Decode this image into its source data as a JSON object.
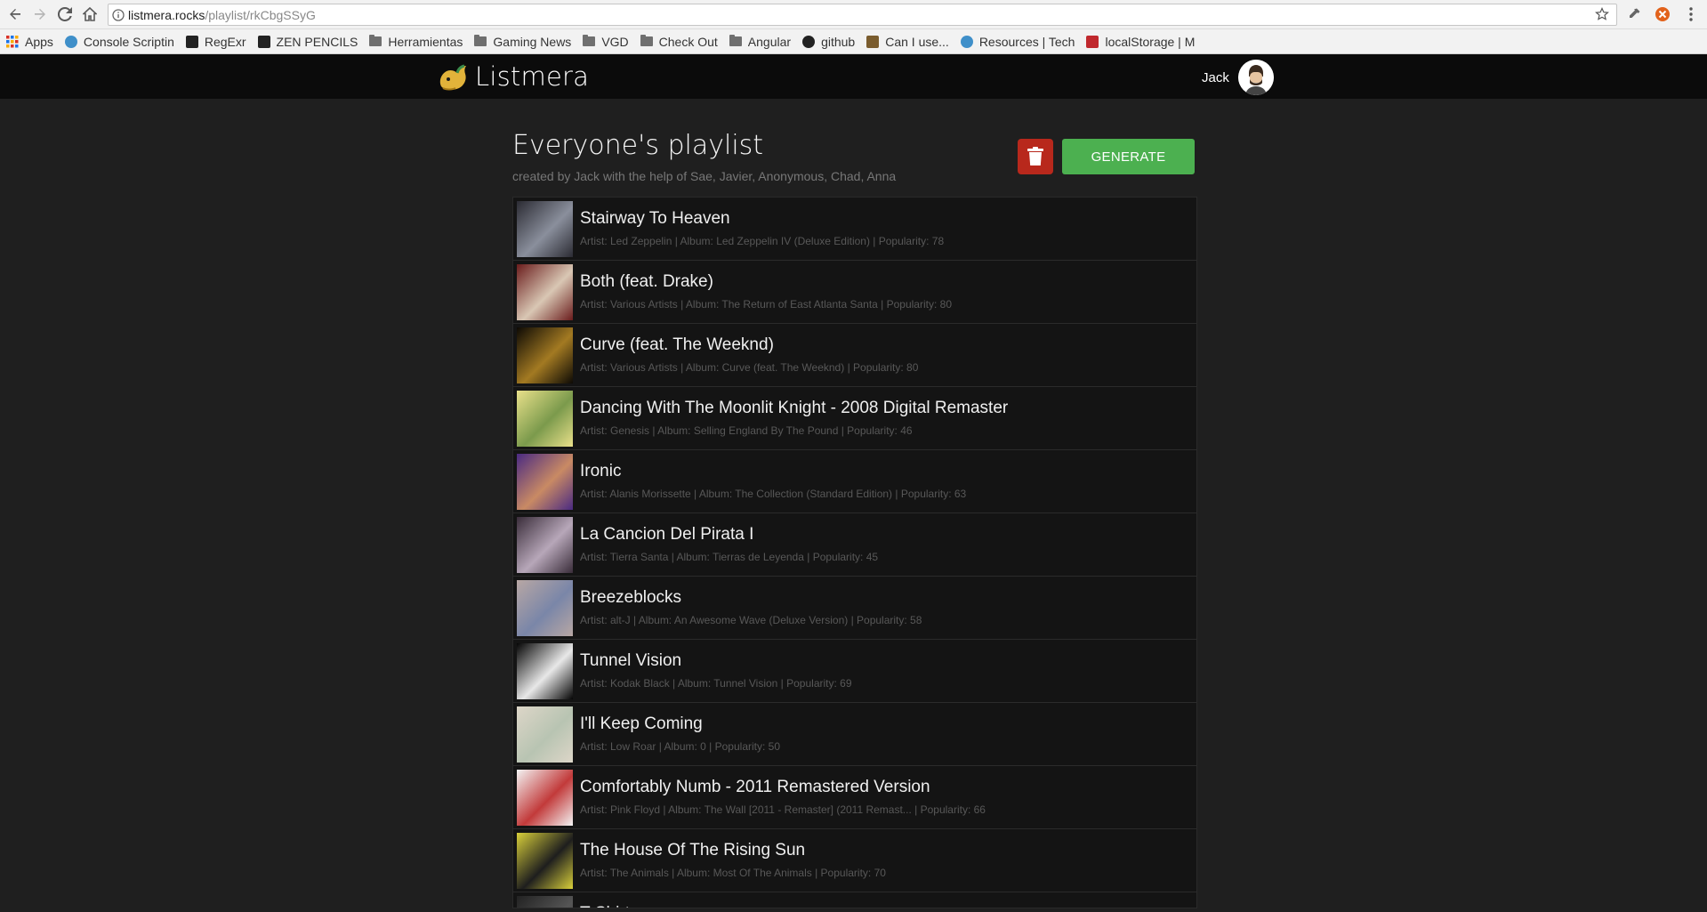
{
  "browser": {
    "url_host": "listmera.rocks",
    "url_path": "/playlist/rkCbgSSyG"
  },
  "bookmarks": [
    {
      "label": "Apps",
      "icon": "apps-grid-icon",
      "color": "#d93025"
    },
    {
      "label": "Console Scriptin",
      "icon": "globe-icon",
      "color": "#3f8fc9"
    },
    {
      "label": "RegExr",
      "icon": "regexr-icon",
      "color": "#222222"
    },
    {
      "label": "ZEN PENCILS",
      "icon": "zen-pencils-icon",
      "color": "#222222"
    },
    {
      "label": "Herramientas",
      "icon": "folder-icon",
      "color": "#6f6f6f"
    },
    {
      "label": "Gaming News",
      "icon": "folder-icon",
      "color": "#6f6f6f"
    },
    {
      "label": "VGD",
      "icon": "folder-icon",
      "color": "#6f6f6f"
    },
    {
      "label": "Check Out",
      "icon": "folder-icon",
      "color": "#6f6f6f"
    },
    {
      "label": "Angular",
      "icon": "folder-icon",
      "color": "#6f6f6f"
    },
    {
      "label": "github",
      "icon": "github-icon",
      "color": "#222222"
    },
    {
      "label": "Can I use...",
      "icon": "caniuse-icon",
      "color": "#7a5c2e"
    },
    {
      "label": "Resources | Tech",
      "icon": "resources-icon",
      "color": "#3f8fc9"
    },
    {
      "label": "localStorage | M",
      "icon": "mdn-icon",
      "color": "#c0282d"
    }
  ],
  "header": {
    "app_name": "Listmera",
    "user_name": "Jack"
  },
  "playlist": {
    "title": "Everyone's playlist",
    "subtitle": "created by Jack with the help of Sae, Javier, Anonymous, Chad, Anna",
    "generate_label": "GENERATE",
    "tracks": [
      {
        "title": "Stairway To Heaven",
        "meta": "Artist: Led Zeppelin | Album: Led Zeppelin IV (Deluxe Edition) | Popularity: 78",
        "cover_colors": [
          "#2b2b33",
          "#8a8f9c"
        ]
      },
      {
        "title": "Both (feat. Drake)",
        "meta": "Artist: Various Artists | Album: The Return of East Atlanta Santa | Popularity: 80",
        "cover_colors": [
          "#6a1c1c",
          "#d9c7b4"
        ]
      },
      {
        "title": "Curve (feat. The Weeknd)",
        "meta": "Artist: Various Artists | Album: Curve (feat. The Weeknd) | Popularity: 80",
        "cover_colors": [
          "#0d0a05",
          "#a37a22"
        ]
      },
      {
        "title": "Dancing With The Moonlit Knight - 2008 Digital Remaster",
        "meta": "Artist: Genesis | Album: Selling England By The Pound | Popularity: 46",
        "cover_colors": [
          "#e9e08a",
          "#7b9a4c"
        ]
      },
      {
        "title": "Ironic",
        "meta": "Artist: Alanis Morissette | Album: The Collection (Standard Edition) | Popularity: 63",
        "cover_colors": [
          "#4a2a82",
          "#c98a64"
        ]
      },
      {
        "title": "La Cancion Del Pirata I",
        "meta": "Artist: Tierra Santa | Album: Tierras de Leyenda | Popularity: 45",
        "cover_colors": [
          "#3a2d3a",
          "#b7a7b9"
        ]
      },
      {
        "title": "Breezeblocks",
        "meta": "Artist: alt-J | Album: An Awesome Wave (Deluxe Version) | Popularity: 58",
        "cover_colors": [
          "#b8a7a4",
          "#7a86a8"
        ]
      },
      {
        "title": "Tunnel Vision",
        "meta": "Artist: Kodak Black | Album: Tunnel Vision | Popularity: 69",
        "cover_colors": [
          "#050505",
          "#e8e8e8"
        ]
      },
      {
        "title": "I'll Keep Coming",
        "meta": "Artist: Low Roar | Album: 0 | Popularity: 50",
        "cover_colors": [
          "#ddd6c8",
          "#b8c4b2"
        ]
      },
      {
        "title": "Comfortably Numb - 2011 Remastered Version",
        "meta": "Artist: Pink Floyd | Album: The Wall [2011 - Remaster] (2011 Remast... | Popularity: 66",
        "cover_colors": [
          "#f3f3f3",
          "#c23a3a"
        ]
      },
      {
        "title": "The House Of The Rising Sun",
        "meta": "Artist: The Animals | Album: Most Of The Animals | Popularity: 70",
        "cover_colors": [
          "#d8cf3a",
          "#1e1e1e"
        ]
      },
      {
        "title": "T-Shirt",
        "meta": "",
        "cover_colors": [
          "#222222",
          "#555555"
        ]
      }
    ]
  }
}
